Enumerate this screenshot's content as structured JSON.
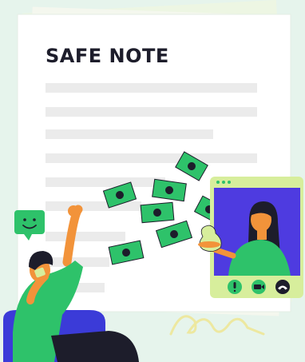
{
  "document": {
    "title": "SAFE NOTE"
  },
  "video_call": {
    "controls": [
      {
        "name": "mic",
        "icon": "microphone-icon"
      },
      {
        "name": "camera",
        "icon": "video-camera-icon"
      },
      {
        "name": "hangup",
        "icon": "phone-hangup-icon"
      }
    ]
  },
  "colors": {
    "background": "#e6f4ec",
    "paper": "#ffffff",
    "lines": "#ebebeb",
    "money_green": "#2ec26a",
    "call_frame": "#d7ee9c",
    "call_screen": "#4e3be0",
    "ink": "#1d1d2b",
    "skin": "#f2933a",
    "chair": "#3b3bd8",
    "accent_yellow": "#ede8a0"
  }
}
